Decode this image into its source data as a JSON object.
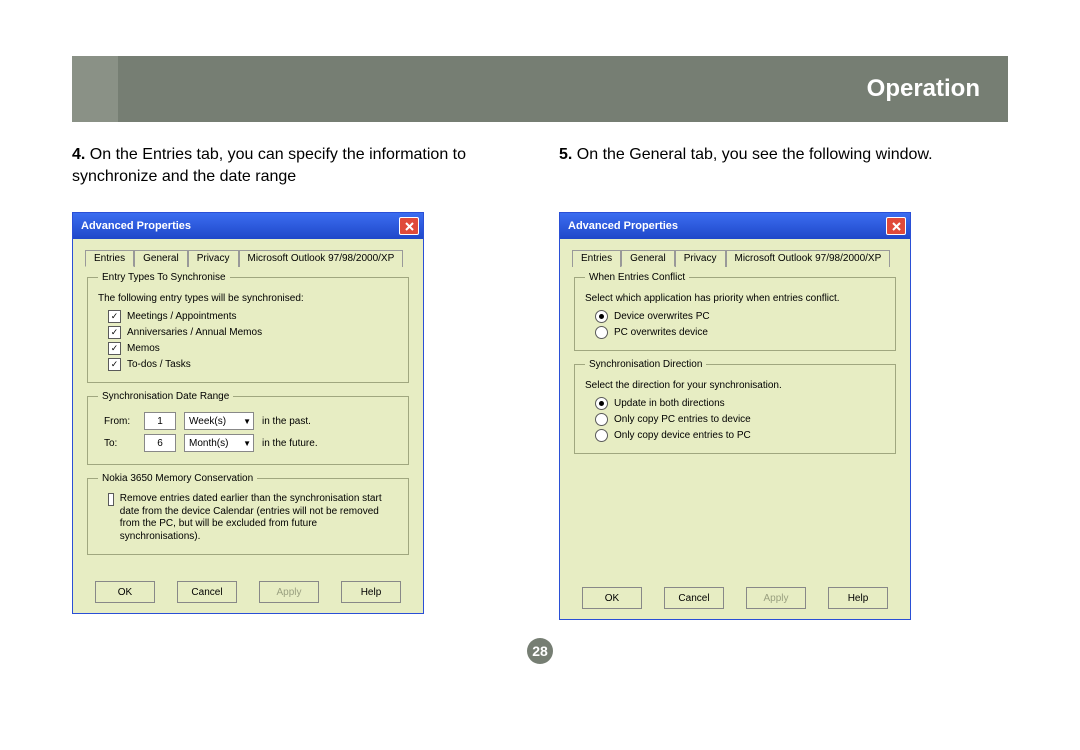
{
  "header": {
    "title": "Operation"
  },
  "page_number": "28",
  "steps": {
    "s4_num": "4.",
    "s4_text": "On the Entries tab, you can specify the information to synchronize and the date range",
    "s5_num": "5.",
    "s5_text": "On the General tab, you see the following window."
  },
  "dlg_left": {
    "title": "Advanced Properties",
    "tabs": {
      "entries": "Entries",
      "general": "General",
      "privacy": "Privacy",
      "outlook": "Microsoft Outlook 97/98/2000/XP"
    },
    "group1": {
      "legend": "Entry Types To Synchronise",
      "intro": "The following entry types will be synchronised:",
      "c1": "Meetings / Appointments",
      "c2": "Anniversaries / Annual Memos",
      "c3": "Memos",
      "c4": "To-dos / Tasks"
    },
    "group2": {
      "legend": "Synchronisation Date Range",
      "from_label": "From:",
      "from_value": "1",
      "from_unit": "Week(s)",
      "from_suffix": "in the past.",
      "to_label": "To:",
      "to_value": "6",
      "to_unit": "Month(s)",
      "to_suffix": "in the future."
    },
    "group3": {
      "legend": "Nokia 3650 Memory Conservation",
      "text": "Remove entries dated earlier than the synchronisation start date from the device Calendar (entries will not be removed from the PC, but will be excluded from future synchronisations)."
    },
    "buttons": {
      "ok": "OK",
      "cancel": "Cancel",
      "apply": "Apply",
      "help": "Help"
    }
  },
  "dlg_right": {
    "title": "Advanced Properties",
    "tabs": {
      "entries": "Entries",
      "general": "General",
      "privacy": "Privacy",
      "outlook": "Microsoft Outlook 97/98/2000/XP"
    },
    "group1": {
      "legend": "When Entries Conflict",
      "intro": "Select which application has priority when entries conflict.",
      "r1": "Device overwrites PC",
      "r2": "PC overwrites device"
    },
    "group2": {
      "legend": "Synchronisation Direction",
      "intro": "Select the direction for your synchronisation.",
      "r1": "Update in both directions",
      "r2": "Only copy PC entries to device",
      "r3": "Only copy device entries to PC"
    },
    "buttons": {
      "ok": "OK",
      "cancel": "Cancel",
      "apply": "Apply",
      "help": "Help"
    }
  }
}
